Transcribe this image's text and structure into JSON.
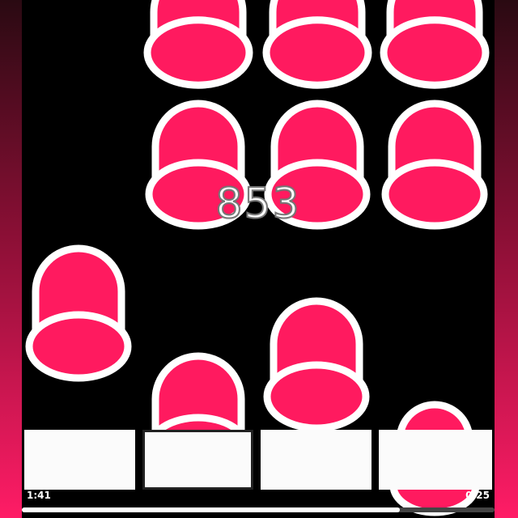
{
  "game": {
    "score": "853",
    "note_color": "#ff1a5f",
    "note_outline": "#ffffff",
    "tile_color": "#fbfbfb",
    "lanes": 4,
    "tiles": [
      {
        "lane": 1,
        "outlined": false
      },
      {
        "lane": 2,
        "outlined": true
      },
      {
        "lane": 3,
        "outlined": false
      },
      {
        "lane": 4,
        "outlined": false
      }
    ]
  },
  "playback": {
    "elapsed": "1:41",
    "remaining": "0:25",
    "progress": 0.8
  }
}
